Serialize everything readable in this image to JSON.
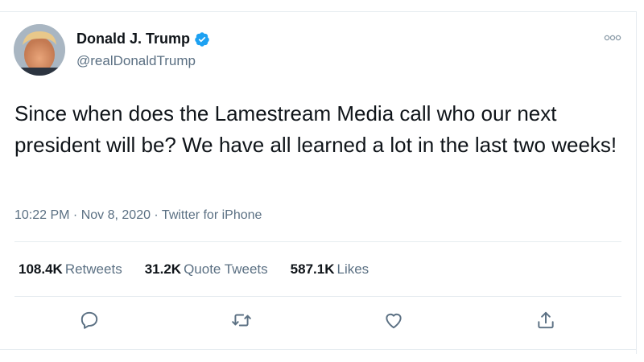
{
  "tweet": {
    "author_name": "Donald J. Trump",
    "handle": "@realDonaldTrump",
    "text": "Since when does the Lamestream Media call who our next president will be? We have all learned a lot in the last two weeks!",
    "time": "10:22 PM",
    "date": "Nov 8, 2020",
    "source": "Twitter for iPhone",
    "separator": " · "
  },
  "stats": {
    "retweets_count": "108.4K",
    "retweets_label": "Retweets",
    "quotes_count": "31.2K",
    "quotes_label": "Quote Tweets",
    "likes_count": "587.1K",
    "likes_label": "Likes"
  },
  "icons": {
    "verified": "verified-badge-icon",
    "more": "more-options-icon",
    "reply": "reply-icon",
    "retweet": "retweet-icon",
    "like": "heart-icon",
    "share": "share-icon"
  },
  "colors": {
    "verified_blue": "#1da1f2",
    "secondary_text": "#5b7083",
    "divider": "#e6ecf0"
  }
}
